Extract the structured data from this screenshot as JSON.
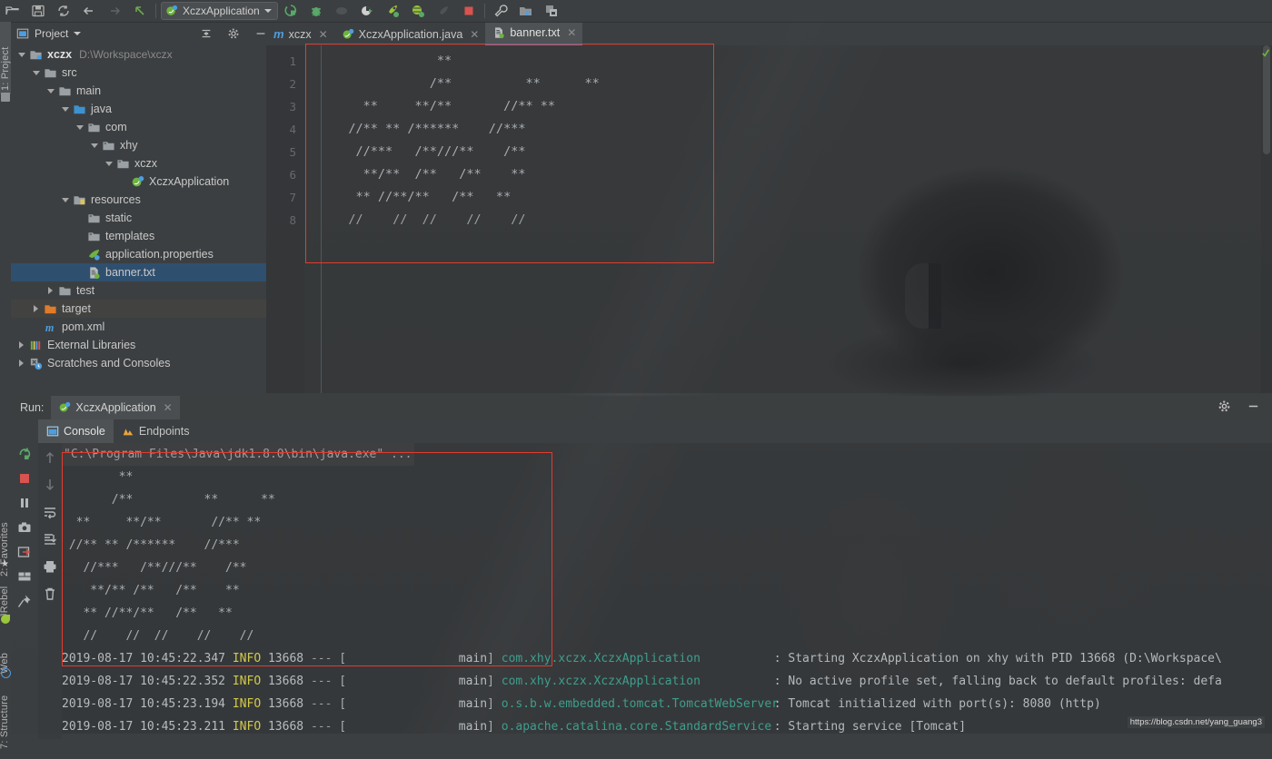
{
  "toolbar": {
    "buttons": [
      {
        "name": "open-folder-icon",
        "glyph": "folder"
      },
      {
        "name": "save-all-icon",
        "glyph": "save"
      },
      {
        "name": "sync-icon",
        "glyph": "sync"
      },
      {
        "name": "back-arrow-icon",
        "glyph": "back"
      },
      {
        "name": "forward-arrow-icon",
        "glyph": "forward"
      },
      {
        "name": "last-edit-location-icon",
        "glyph": "pointer"
      }
    ],
    "run_config": {
      "label": "XczxApplication",
      "icon": "spring-boot-icon"
    },
    "right_buttons": [
      {
        "name": "run-icon",
        "glyph": "run"
      },
      {
        "name": "debug-icon",
        "glyph": "debug"
      },
      {
        "name": "run-with-coverage-icon",
        "glyph": "coverage"
      },
      {
        "name": "profile-icon",
        "glyph": "profile"
      },
      {
        "name": "jrebel-run-icon",
        "glyph": "jrebel-run"
      },
      {
        "name": "jrebel-debug-icon",
        "glyph": "jrebel-debug"
      },
      {
        "name": "jrebel-extra-icon",
        "glyph": "jrebel-extra"
      },
      {
        "name": "stop-icon",
        "glyph": "stop"
      },
      {
        "name": "settings-wrench-icon",
        "glyph": "wrench"
      },
      {
        "name": "project-structure-icon",
        "glyph": "structure"
      },
      {
        "name": "search-everywhere-icon",
        "glyph": "sync-db"
      }
    ]
  },
  "project_panel": {
    "title": "Project",
    "header_buttons": [
      "collapse-all-icon",
      "gear-icon",
      "hide-icon"
    ]
  },
  "left_rail": {
    "top_tab": "1: Project",
    "tabs": [
      "2: Favorites",
      "JRebel",
      "Web",
      "7: Structure"
    ]
  },
  "tree": [
    {
      "label": "xczx",
      "suffix": "D:\\Workspace\\xczx",
      "depth": 0,
      "arrow": "down",
      "icon": "module-icon",
      "bold": true,
      "selected": false
    },
    {
      "label": "src",
      "suffix": "",
      "depth": 1,
      "arrow": "down",
      "icon": "folder-icon",
      "bold": false,
      "selected": false
    },
    {
      "label": "main",
      "suffix": "",
      "depth": 2,
      "arrow": "down",
      "icon": "folder-icon",
      "bold": false,
      "selected": false
    },
    {
      "label": "java",
      "suffix": "",
      "depth": 3,
      "arrow": "down",
      "icon": "source-root-icon",
      "bold": false,
      "selected": false
    },
    {
      "label": "com",
      "suffix": "",
      "depth": 4,
      "arrow": "down",
      "icon": "package-icon",
      "bold": false,
      "selected": false
    },
    {
      "label": "xhy",
      "suffix": "",
      "depth": 5,
      "arrow": "down",
      "icon": "package-icon",
      "bold": false,
      "selected": false
    },
    {
      "label": "xczx",
      "suffix": "",
      "depth": 6,
      "arrow": "down",
      "icon": "package-icon",
      "bold": false,
      "selected": false
    },
    {
      "label": "XczxApplication",
      "suffix": "",
      "depth": 7,
      "arrow": "none",
      "icon": "spring-class-icon",
      "bold": false,
      "selected": false
    },
    {
      "label": "resources",
      "suffix": "",
      "depth": 3,
      "arrow": "down",
      "icon": "resources-root-icon",
      "bold": false,
      "selected": false
    },
    {
      "label": "static",
      "suffix": "",
      "depth": 4,
      "arrow": "none",
      "icon": "package-icon",
      "bold": false,
      "selected": false
    },
    {
      "label": "templates",
      "suffix": "",
      "depth": 4,
      "arrow": "none",
      "icon": "package-icon",
      "bold": false,
      "selected": false
    },
    {
      "label": "application.properties",
      "suffix": "",
      "depth": 4,
      "arrow": "none",
      "icon": "spring-properties-icon",
      "bold": false,
      "selected": false
    },
    {
      "label": "banner.txt",
      "suffix": "",
      "depth": 4,
      "arrow": "none",
      "icon": "text-file-icon",
      "bold": false,
      "selected": true
    },
    {
      "label": "test",
      "suffix": "",
      "depth": 2,
      "arrow": "right",
      "icon": "folder-icon",
      "bold": false,
      "selected": false
    },
    {
      "label": "target",
      "suffix": "",
      "depth": 1,
      "arrow": "right",
      "icon": "excluded-folder-icon",
      "bold": false,
      "selected": false,
      "highlight": true
    },
    {
      "label": "pom.xml",
      "suffix": "",
      "depth": 1,
      "arrow": "none",
      "icon": "maven-icon",
      "bold": false,
      "selected": false
    },
    {
      "label": "External Libraries",
      "suffix": "",
      "depth": 0,
      "arrow": "right",
      "icon": "libraries-icon",
      "bold": false,
      "selected": false
    },
    {
      "label": "Scratches and Consoles",
      "suffix": "",
      "depth": 0,
      "arrow": "right",
      "icon": "scratches-icon",
      "bold": false,
      "selected": false
    }
  ],
  "editor_tabs": [
    {
      "label": "xczx",
      "icon": "maven-m-icon",
      "active": false
    },
    {
      "label": "XczxApplication.java",
      "icon": "spring-class-icon",
      "active": false
    },
    {
      "label": "banner.txt",
      "icon": "text-file-icon",
      "active": true
    }
  ],
  "editor": {
    "line_numbers": [
      "1",
      "2",
      "3",
      "4",
      "5",
      "6",
      "7",
      "8"
    ],
    "lines": [
      "               **",
      "              /**          **      **",
      "     **     **/**       //** **",
      "   //** ** /******    //***",
      "    //***   /**///**    /**",
      "     **/**  /**   /**    **",
      "    ** //**/**   /**   **",
      "   //    //  //    //    //"
    ]
  },
  "run_panel": {
    "run_label": "Run:",
    "config_tab": "XczxApplication",
    "subtabs": [
      {
        "label": "Console",
        "icon": "console-icon",
        "active": true
      },
      {
        "label": "Endpoints",
        "icon": "endpoints-icon",
        "active": false
      }
    ],
    "left_buttons": [
      "rerun-icon",
      "stop-icon",
      "pause-icon",
      "camera-icon",
      "export-icon",
      "layout-icon",
      "pin-icon"
    ],
    "second_buttons": [
      "scroll-up-icon",
      "scroll-down-icon",
      "soft-wrap-icon",
      "scroll-to-end-icon",
      "print-icon",
      "trash-icon"
    ],
    "right_buttons": [
      "gear-icon",
      "hide-icon"
    ]
  },
  "console": {
    "command_line": "\"C:\\Program Files\\Java\\jdk1.8.0\\bin\\java.exe\" ...",
    "banner_lines": [
      "        **",
      "       /**          **      **",
      "  **     **/**       //** **",
      " //** ** /******    //***",
      "   //***   /**///**    /**",
      "    **/** /**   /**    **",
      "   ** //**/**   /**   **",
      "   //    //  //    //    //"
    ],
    "log_lines": [
      {
        "ts": "2019-08-17 10:45:22.347",
        "level": "INFO",
        "pid": "13668",
        "sep": "---",
        "thread": "main",
        "logger": "com.xhy.xczx.XczxApplication",
        "msg": ": Starting XczxApplication on xhy with PID 13668 (D:\\Workspace\\"
      },
      {
        "ts": "2019-08-17 10:45:22.352",
        "level": "INFO",
        "pid": "13668",
        "sep": "---",
        "thread": "main",
        "logger": "com.xhy.xczx.XczxApplication",
        "msg": ": No active profile set, falling back to default profiles: defa"
      },
      {
        "ts": "2019-08-17 10:45:23.194",
        "level": "INFO",
        "pid": "13668",
        "sep": "---",
        "thread": "main",
        "logger": "o.s.b.w.embedded.tomcat.TomcatWebServer",
        "msg": ": Tomcat initialized with port(s): 8080 (http)"
      },
      {
        "ts": "2019-08-17 10:45:23.211",
        "level": "INFO",
        "pid": "13668",
        "sep": "---",
        "thread": "main",
        "logger": "o.apache.catalina.core.StandardService",
        "msg": ": Starting service [Tomcat]"
      }
    ]
  },
  "watermark": "https://blog.csdn.net/yang_guang3",
  "colors": {
    "accent_blue": "#4d7fbc",
    "selection": "#2f4f6f",
    "annotation_red": "#e33b2e",
    "info_yellow": "#d2c94a",
    "logger_teal": "#3e9e8e",
    "panel_bg": "#3c3f41",
    "editor_bg": "#2b2b2b"
  }
}
